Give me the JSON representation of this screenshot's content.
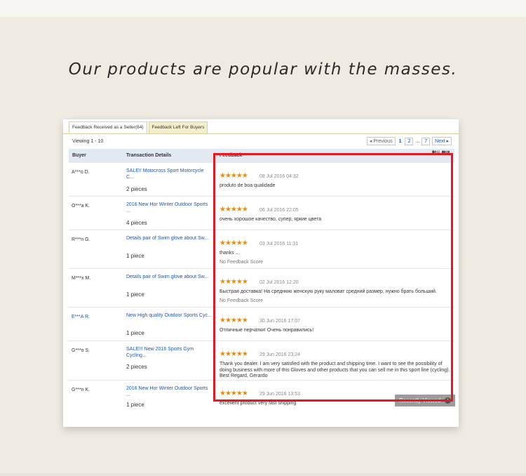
{
  "headline": "Our products are popular with the masses.",
  "tabs": [
    {
      "label": "Feedback Received as a Seller(64)"
    },
    {
      "label": "Feedback Left For Buyers"
    }
  ],
  "viewing": "Viewing 1 - 10",
  "pager": {
    "previous": "◂ Previous",
    "current": "1",
    "page2": "2",
    "ellipsis": "...",
    "last": "7",
    "next": "Next ▸"
  },
  "table": {
    "col_buyer": "Buyer",
    "col_transaction": "Transaction Details",
    "col_feedback": "Feedback",
    "col_extra": "默认 翻译",
    "rows": [
      {
        "buyer": "A***o D.",
        "buyer_link": false,
        "product": "SALE!! Motocross Sport Motorcycle C...",
        "qty": "2 pieces",
        "stars": "★★★★★",
        "date": "08 Jul 2016 04:32",
        "text": "produto de boa qualidade",
        "note": ""
      },
      {
        "buyer": "O***a K.",
        "buyer_link": false,
        "product": "2016 New Hor Winter Outdoor Sports ...",
        "qty": "4 pieces",
        "stars": "★★★★★",
        "date": "06 Jul 2016 22:05",
        "text": "очень хорошое качество, супер, яркие цвета",
        "note": ""
      },
      {
        "buyer": "R***n G.",
        "buyer_link": false,
        "product": "Details pair of Swim glove about Sw...",
        "qty": "1 piece",
        "stars": "★★★★★",
        "date": "03 Jul 2016 11:31",
        "text": "thanks ...",
        "note": "No Feedback Score"
      },
      {
        "buyer": "M***x M.",
        "buyer_link": false,
        "product": "Details pair of Swim glove about Sw...",
        "qty": "1 piece",
        "stars": "★★★★★",
        "date": "02 Jul 2016 12:20",
        "text": "Быстрая доставка! На среднюю женскую руку маловат средний размер, нужно брать больший.",
        "note": "No Feedback Score"
      },
      {
        "buyer": "E***A R.",
        "buyer_link": true,
        "product": "New High quality Outdoor Sports Cyc...",
        "qty": "1 piece",
        "stars": "★★★★★",
        "date": "30 Jun 2016 17:07",
        "text": "Отличные перчатки! Очень понравились!",
        "note": ""
      },
      {
        "buyer": "G***o S.",
        "buyer_link": false,
        "product": "SALE!!! New 2016 Sports Gym Cycling...",
        "qty": "2 pieces",
        "stars": "★★★★★",
        "date": "29 Jun 2016 23:24",
        "text": "Thank you dealer. I am very satisfied with the product and shipping time. I want to see the possibility of doing business with more of this Gloves and other products that you can sell me in this sport line (cycling). Best Regard, Gerardo",
        "note": ""
      },
      {
        "buyer": "G***n K.",
        "buyer_link": false,
        "product": "2016 New Hor Winter Outdoor Sports ...",
        "qty": "1 piece",
        "stars": "★★★★★",
        "date": "29 Jun 2016 13:53",
        "text": "excellent product very fast shipping",
        "note": ""
      }
    ]
  },
  "recently_viewed": "Recently Viewed",
  "colors": {
    "highlight": "#e01b22",
    "link": "#1a56b5",
    "stars": "#f08a00"
  }
}
